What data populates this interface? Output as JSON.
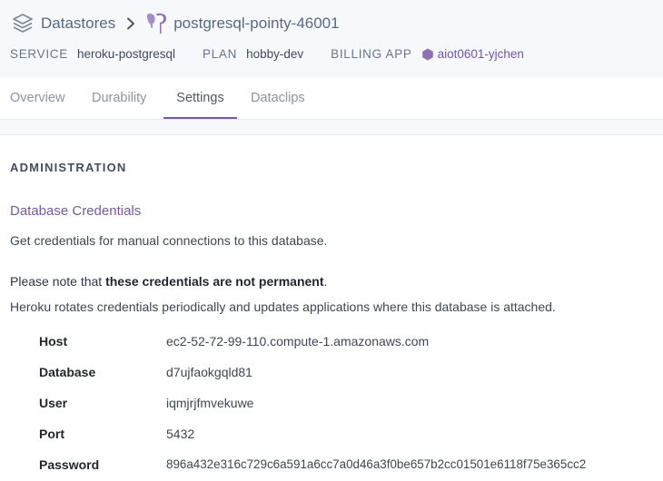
{
  "breadcrumb": {
    "root_label": "Datastores",
    "root_icon": "stack-icon",
    "separator_icon": "chevron-right-icon",
    "current_icon": "postgres-elephant-icon",
    "current_label": "postgresql-pointy-46001"
  },
  "meta": {
    "service_label": "SERVICE",
    "service_value": "heroku-postgresql",
    "plan_label": "PLAN",
    "plan_value": "hobby-dev",
    "billing_label": "BILLING APP",
    "billing_icon": "hexagon-app-icon",
    "billing_value": "aiot0601-yjchen"
  },
  "tabs": [
    {
      "label": "Overview",
      "active": false
    },
    {
      "label": "Durability",
      "active": false
    },
    {
      "label": "Settings",
      "active": true
    },
    {
      "label": "Dataclips",
      "active": false
    }
  ],
  "administration": {
    "heading": "ADMINISTRATION",
    "card_title": "Database Credentials",
    "description": "Get credentials for manual connections to this database.",
    "note_prefix": "Please note that ",
    "note_bold": "these credentials are not permanent",
    "note_suffix": ".",
    "rotation_note": "Heroku rotates credentials periodically and updates applications where this database is attached."
  },
  "credentials": [
    {
      "key": "Host",
      "value": "ec2-52-72-99-110.compute-1.amazonaws.com"
    },
    {
      "key": "Database",
      "value": "d7ujfaokgqld81"
    },
    {
      "key": "User",
      "value": "iqmjrjfmvekuwe"
    },
    {
      "key": "Port",
      "value": "5432"
    },
    {
      "key": "Password",
      "value": "896a432e316c729c6a591a6cc7a0d46a3f0be657b2cc01501e6118f75e365cc2"
    }
  ],
  "colors": {
    "accent": "#79589f",
    "header_bg": "#f7f8fb",
    "link": "#6e58a8"
  }
}
